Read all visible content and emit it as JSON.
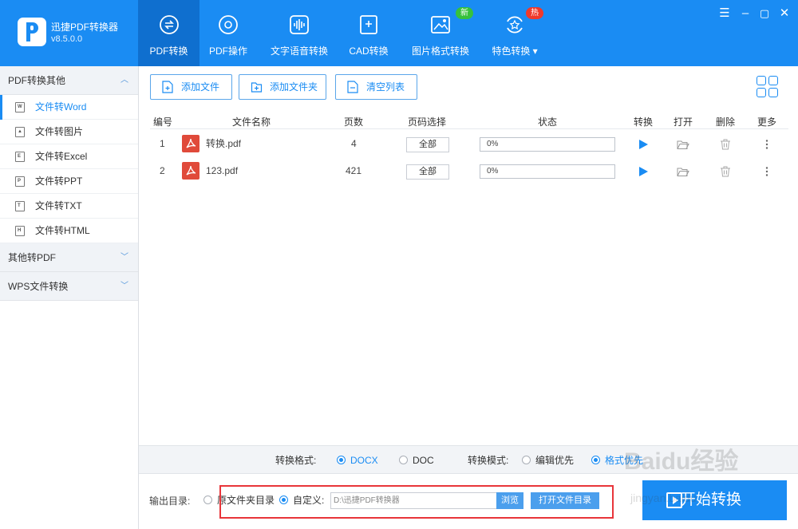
{
  "app": {
    "title": "迅捷PDF转换器",
    "version": "v8.5.0.0"
  },
  "nav": {
    "tabs": [
      {
        "label": "PDF转换",
        "icon": "pdf-convert-icon",
        "active": true
      },
      {
        "label": "PDF操作",
        "icon": "pdf-operate-icon"
      },
      {
        "label": "文字语音转换",
        "icon": "voice-wave-icon"
      },
      {
        "label": "CAD转换",
        "icon": "cad-icon"
      },
      {
        "label": "图片格式转换",
        "icon": "image-icon",
        "badge": "新"
      },
      {
        "label": "特色转换 ▾",
        "icon": "star-refresh-icon",
        "badge": "热"
      }
    ]
  },
  "window": {
    "minimize": "–",
    "restore": "▢",
    "close": "✕",
    "menu": "☰"
  },
  "sidebar": {
    "section1": "PDF转换其他",
    "items": [
      {
        "label": "文件转Word",
        "icon_letter": "W",
        "active": true
      },
      {
        "label": "文件转图片",
        "icon_letter": "▲"
      },
      {
        "label": "文件转Excel",
        "icon_letter": "E"
      },
      {
        "label": "文件转PPT",
        "icon_letter": "P"
      },
      {
        "label": "文件转TXT",
        "icon_letter": "T"
      },
      {
        "label": "文件转HTML",
        "icon_letter": "H"
      }
    ],
    "section2": "其他转PDF",
    "section3": "WPS文件转换"
  },
  "toolbar": {
    "add_file": "添加文件",
    "add_folder": "添加文件夹",
    "clear_list": "清空列表"
  },
  "table": {
    "headers": {
      "num": "编号",
      "name": "文件名称",
      "pages": "页数",
      "page_select": "页码选择",
      "status": "状态",
      "convert": "转换",
      "open": "打开",
      "delete": "删除",
      "more": "更多"
    },
    "rows": [
      {
        "num": "1",
        "name": "转换.pdf",
        "pages": "4",
        "page_select": "全部",
        "progress": "0%",
        "progress_value": 0
      },
      {
        "num": "2",
        "name": "123.pdf",
        "pages": "421",
        "page_select": "全部",
        "progress": "0%",
        "progress_value": 0
      }
    ]
  },
  "options": {
    "format_label": "转换格式:",
    "format_docx": "DOCX",
    "format_doc": "DOC",
    "mode_label": "转换模式:",
    "mode_edit": "编辑优先",
    "mode_format": "格式优先"
  },
  "output": {
    "label": "输出目录:",
    "original": "原文件夹目录",
    "custom": "自定义:",
    "path": "D:\\迅捷PDF转换器",
    "browse": "浏览",
    "open_dir": "打开文件目录"
  },
  "start_button": "开始转换",
  "watermark": {
    "main": "Baidu经验",
    "sub": "jingyan.baidu"
  },
  "colors": {
    "brand": "#1a8cf3",
    "nav_active": "#0f6fcf",
    "badge_new": "#37c13c",
    "badge_hot": "#f0392b",
    "highlight": "#e8353a",
    "pdf_icon": "#e04a3a"
  }
}
